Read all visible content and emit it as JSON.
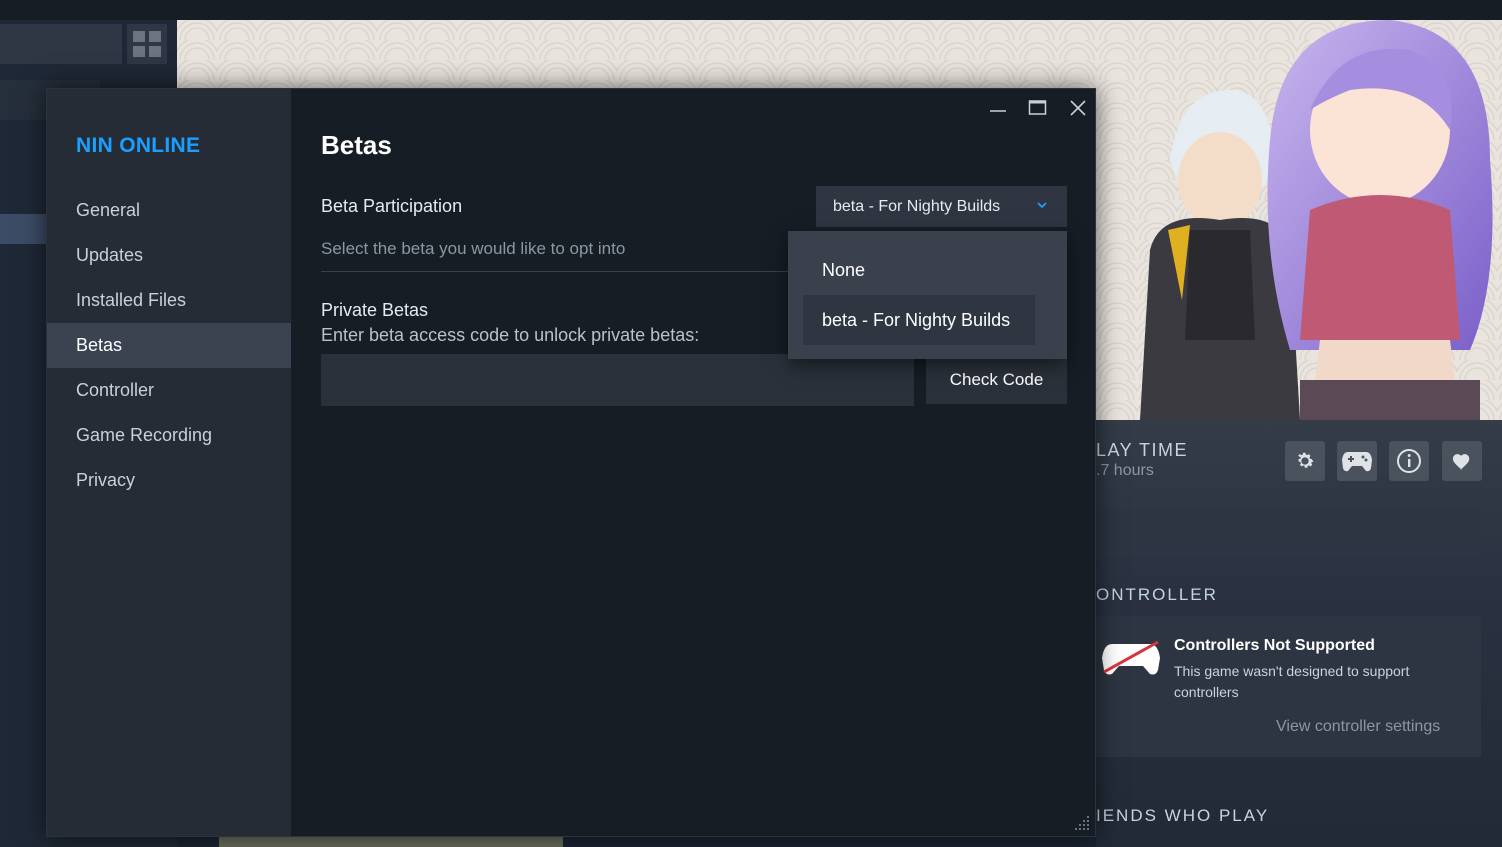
{
  "dialog": {
    "game_title": "NIN ONLINE",
    "nav": [
      {
        "label": "General"
      },
      {
        "label": "Updates"
      },
      {
        "label": "Installed Files"
      },
      {
        "label": "Betas",
        "active": true
      },
      {
        "label": "Controller"
      },
      {
        "label": "Game Recording"
      },
      {
        "label": "Privacy"
      }
    ],
    "page_title": "Betas",
    "beta_participation": {
      "label": "Beta Participation",
      "description": "Select the beta you would like to opt into",
      "selected": "beta - For Nighty Builds",
      "options": [
        "None",
        "beta - For Nighty Builds"
      ]
    },
    "private_betas": {
      "label": "Private Betas",
      "description": "Enter beta access code to unlock private betas:",
      "input_value": "",
      "button_label": "Check Code"
    },
    "window_controls": [
      "minimize-icon",
      "maximize-icon",
      "close-icon"
    ]
  },
  "background": {
    "play_time_label": "LAY TIME",
    "play_time_value": ".7 hours",
    "controller_section_title": "ONTROLLER",
    "controller_card": {
      "title": "Controllers Not Supported",
      "description": "This game wasn't designed to support controllers",
      "link": "View controller settings"
    },
    "friends_section_title": "IENDS WHO PLAY",
    "action_icons": [
      "gear-icon",
      "gamepad-icon",
      "info-icon",
      "heart-icon"
    ]
  },
  "colors": {
    "accent": "#1a9fff",
    "dialog_bg": "#171d25",
    "sidebar_bg": "#262c36",
    "nav_active_bg": "#3b4351",
    "menu_bg": "#3a404c"
  }
}
